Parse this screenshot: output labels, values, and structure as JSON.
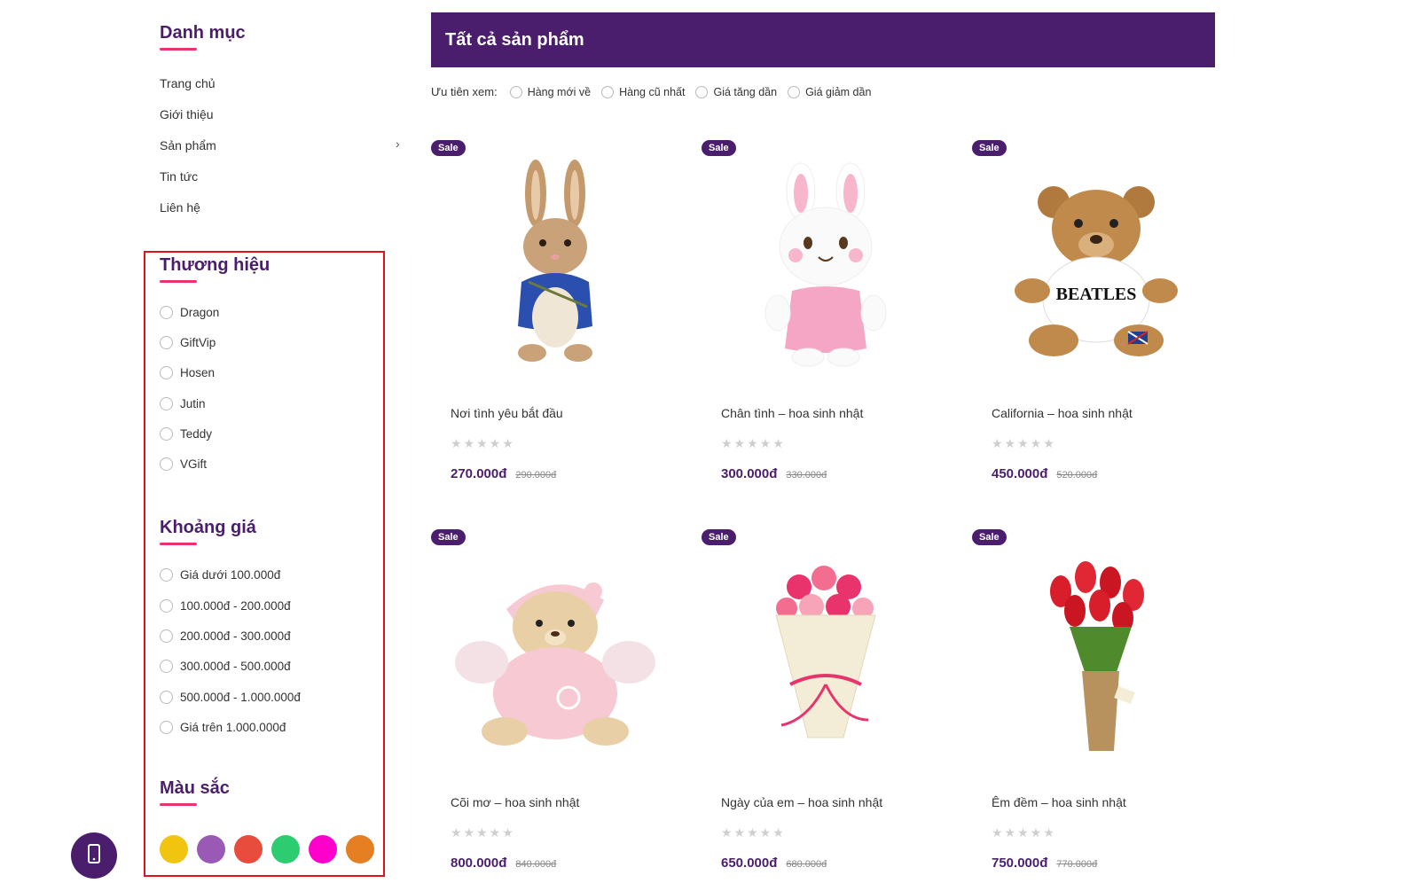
{
  "sidebar": {
    "category_title": "Danh mục",
    "nav": [
      "Trang chủ",
      "Giới thiệu",
      "Sản phẩm",
      "Tin tức",
      "Liên hệ"
    ],
    "nav_arrow": "›",
    "brand_title": "Thương hiệu",
    "brands": [
      "Dragon",
      "GiftVip",
      "Hosen",
      "Jutin",
      "Teddy",
      "VGift"
    ],
    "price_title": "Khoảng giá",
    "price_ranges": [
      "Giá dưới 100.000đ",
      "100.000đ - 200.000đ",
      "200.000đ - 300.000đ",
      "300.000đ - 500.000đ",
      "500.000đ - 1.000.000đ",
      "Giá trên 1.000.000đ"
    ],
    "color_title": "Màu sắc",
    "colors": [
      "#f1c40f",
      "#9b59b6",
      "#e74c3c",
      "#2ecc71",
      "#ff00cc",
      "#e67e22"
    ]
  },
  "main": {
    "title": "Tất cả sản phẩm",
    "sort_label": "Ưu tiên xem:",
    "sort_options": [
      "Hàng mới về",
      "Hàng cũ nhất",
      "Giá tăng dần",
      "Giá giảm dần"
    ],
    "sale_label": "Sale",
    "stars": "★★★★★",
    "products": [
      {
        "name": "Nơi tình yêu bắt đầu",
        "price": "270.000đ",
        "old_price": "290.000đ",
        "image": "bunny-jacket-icon"
      },
      {
        "name": "Chân tình – hoa sinh nhật",
        "price": "300.000đ",
        "old_price": "330.000đ",
        "image": "pink-bunny-icon"
      },
      {
        "name": "California – hoa sinh nhật",
        "price": "450.000đ",
        "old_price": "520.000đ",
        "image": "teddy-bear-icon"
      },
      {
        "name": "Cõi mơ – hoa sinh nhật",
        "price": "800.000đ",
        "old_price": "840.000đ",
        "image": "pink-bear-icon"
      },
      {
        "name": "Ngày của em – hoa sinh nhật",
        "price": "650.000đ",
        "old_price": "680.000đ",
        "image": "rose-bouquet-icon"
      },
      {
        "name": "Êm đềm – hoa sinh nhật",
        "price": "750.000đ",
        "old_price": "770.000đ",
        "image": "tulip-bouquet-icon"
      }
    ]
  },
  "floating": {
    "icon": "phone-icon"
  }
}
